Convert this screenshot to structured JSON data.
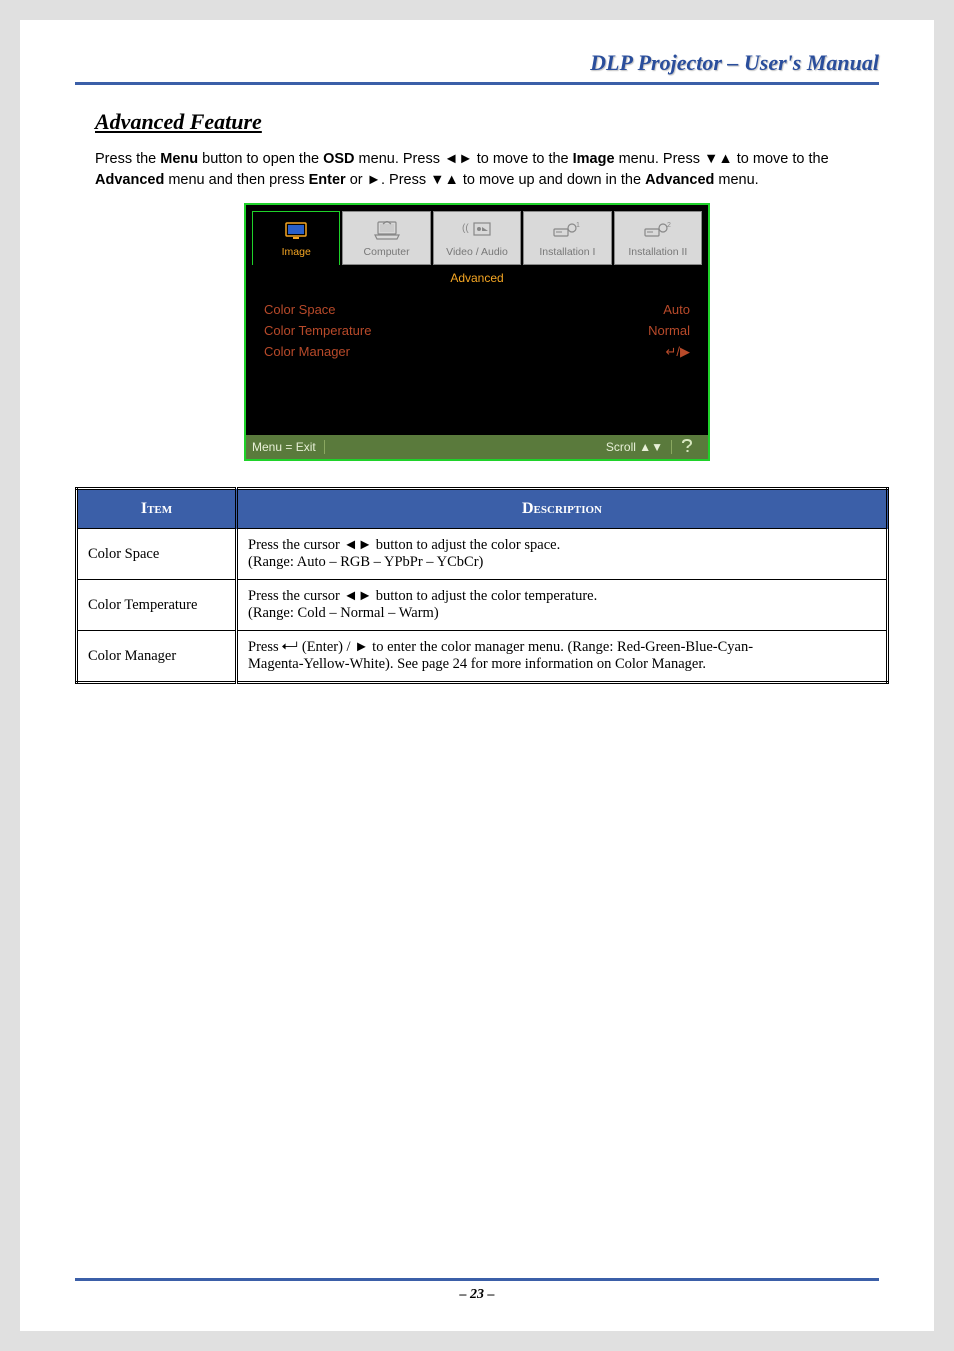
{
  "header": {
    "title": "DLP Projector – User's Manual"
  },
  "section": {
    "heading": "Advanced Feature",
    "para1_pre": "Press the ",
    "para1_menu": "Menu",
    "para1_mid1": " button to open the ",
    "para1_osd": "OSD",
    "para1_mid2": " menu. Press ◄► to move to the ",
    "para1_image": "Image",
    "para1_mid3": " menu. Press ▼▲ to move to the ",
    "para1_advanced": "Advanced",
    "para1_mid4": " menu and then press ",
    "para1_enter": "Enter",
    "para1_mid5": " or ►. Press ▼▲ to move up and down in the ",
    "para1_advanced2": "Advanced",
    "para1_end": " menu."
  },
  "osd": {
    "tabs": [
      {
        "label": "Image",
        "active": true
      },
      {
        "label": "Computer",
        "active": false
      },
      {
        "label": "Video / Audio",
        "active": false
      },
      {
        "label": "Installation I",
        "active": false
      },
      {
        "label": "Installation II",
        "active": false
      }
    ],
    "subtitle": "Advanced",
    "rows": [
      {
        "label": "Color Space",
        "value": "Auto"
      },
      {
        "label": "Color Temperature",
        "value": "Normal"
      },
      {
        "label": "Color Manager",
        "value": "↵/▶"
      }
    ],
    "footer": {
      "left": "Menu = Exit",
      "mid": "Scroll ▲▼",
      "right_icon": "❔"
    }
  },
  "table": {
    "head_item": "Item",
    "head_desc": "Description",
    "rows": [
      {
        "item": "Color Space",
        "desc_l1": "Press the cursor ◄► button to adjust the color space.",
        "desc_l2": "(Range: Auto – RGB – YPbPr – YCbCr)"
      },
      {
        "item": "Color Temperature",
        "desc_l1": "Press the cursor ◄► button to adjust the color temperature.",
        "desc_l2": "(Range: Cold – Normal – Warm)"
      },
      {
        "item": "Color Manager",
        "desc_l1_pre": "Press ",
        "desc_l1_mid": " (Enter) / ► to enter the color manager menu. (Range: Red-Green-Blue-Cyan-",
        "desc_l2": "Magenta-Yellow-White). See page 24 for more information on Color Manager."
      }
    ]
  },
  "footer": {
    "page": "– 23 –"
  }
}
